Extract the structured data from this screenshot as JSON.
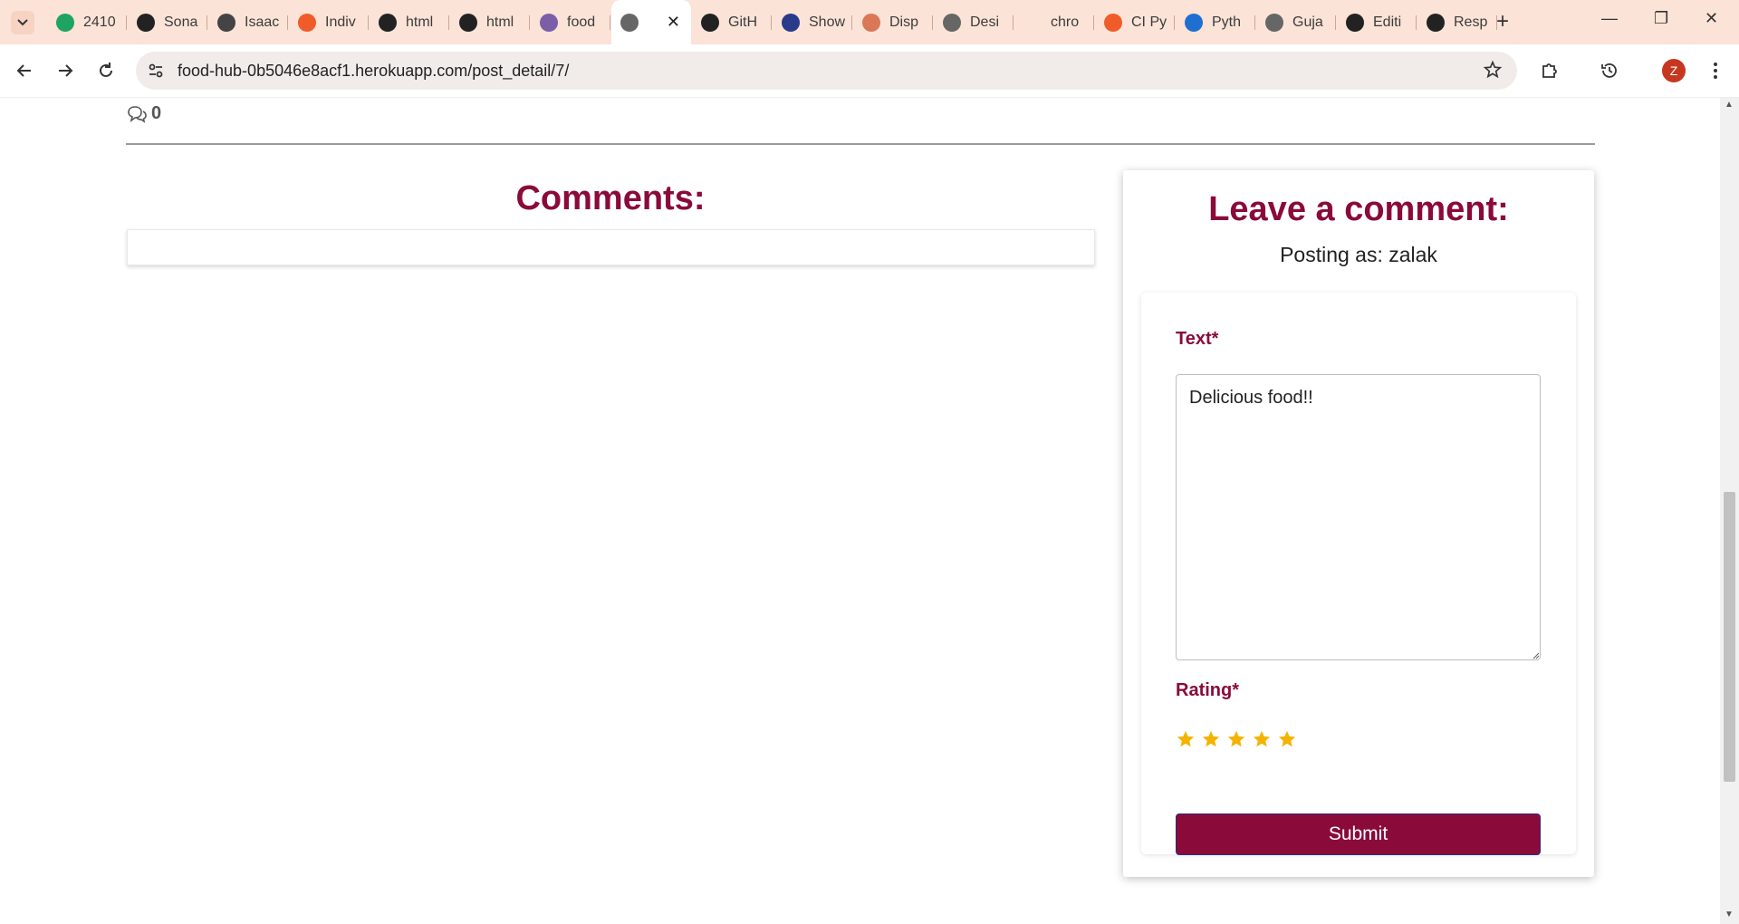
{
  "browser": {
    "tabs": [
      {
        "title": "2410",
        "favicon": "sheets-icon",
        "color": "#1ea362"
      },
      {
        "title": "Sona",
        "favicon": "github-icon",
        "color": "#222"
      },
      {
        "title": "Isaac",
        "favicon": "github-icon",
        "color": "#444"
      },
      {
        "title": "Indiv",
        "favicon": "opera-icon",
        "color": "#f05b2a"
      },
      {
        "title": "html",
        "favicon": "github-icon",
        "color": "#222"
      },
      {
        "title": "html",
        "favicon": "github-icon",
        "color": "#222"
      },
      {
        "title": "food",
        "favicon": "heroku-icon",
        "color": "#7b5ea7"
      },
      {
        "title": "",
        "favicon": "globe-icon",
        "color": "#666",
        "active": true
      },
      {
        "title": "GitH",
        "favicon": "github-icon",
        "color": "#222"
      },
      {
        "title": "Show",
        "favicon": "w3-icon",
        "color": "#2a3a8a"
      },
      {
        "title": "Disp",
        "favicon": "claude-icon",
        "color": "#d97757"
      },
      {
        "title": "Desi",
        "favicon": "globe-icon",
        "color": "#666"
      },
      {
        "title": "chro",
        "favicon": "blank-icon",
        "color": "#fbe3d7"
      },
      {
        "title": "CI Py",
        "favicon": "opera-icon",
        "color": "#f05b2a"
      },
      {
        "title": "Pyth",
        "favicon": "fmt-icon",
        "color": "#1f6fd1"
      },
      {
        "title": "Guja",
        "favicon": "globe-icon",
        "color": "#666"
      },
      {
        "title": "Editi",
        "favicon": "github-icon",
        "color": "#222"
      },
      {
        "title": "Resp",
        "favicon": "openai-icon",
        "color": "#222"
      }
    ],
    "url": "food-hub-0b5046e8acf1.herokuapp.com/post_detail/7/",
    "profile_initial": "Z"
  },
  "post": {
    "comment_count": "0"
  },
  "comments": {
    "title": "Comments:"
  },
  "comment_form": {
    "title": "Leave a comment:",
    "posting_as": "Posting as: zalak",
    "text_label": "Text*",
    "text_value": "Delicious food!!",
    "rating_label": "Rating*",
    "rating_value": 5,
    "rating_max": 5,
    "star_color": "#f5b301",
    "submit_label": "Submit"
  }
}
